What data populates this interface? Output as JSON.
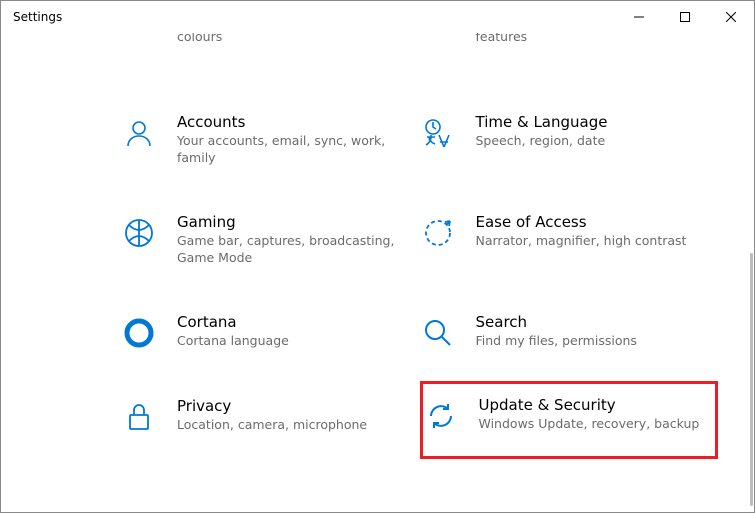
{
  "window": {
    "title": "Settings"
  },
  "categories": {
    "personalization": {
      "desc_partial": "colours"
    },
    "apps": {
      "desc_partial": "features"
    },
    "accounts": {
      "title": "Accounts",
      "desc": "Your accounts, email, sync, work, family"
    },
    "time_language": {
      "title": "Time & Language",
      "desc": "Speech, region, date"
    },
    "gaming": {
      "title": "Gaming",
      "desc": "Game bar, captures, broadcasting, Game Mode"
    },
    "ease_of_access": {
      "title": "Ease of Access",
      "desc": "Narrator, magnifier, high contrast"
    },
    "cortana": {
      "title": "Cortana",
      "desc": "Cortana language"
    },
    "search": {
      "title": "Search",
      "desc": "Find my files, permissions"
    },
    "privacy": {
      "title": "Privacy",
      "desc": "Location, camera, microphone"
    },
    "update_security": {
      "title": "Update & Security",
      "desc": "Windows Update, recovery, backup"
    }
  }
}
